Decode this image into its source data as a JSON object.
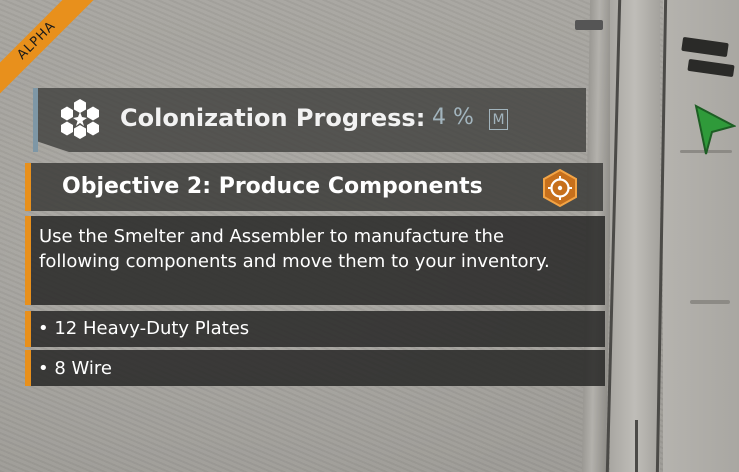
{
  "badge": {
    "text": "ALPHA"
  },
  "colonization": {
    "label": "Colonization Progress:",
    "value": "4 %",
    "key_hint": "M",
    "icon": "hex-cluster-icon"
  },
  "objective": {
    "title": "Objective 2: Produce Components",
    "icon": "target-hex-icon",
    "description": "Use the Smelter and Assembler to manufacture the following components and move them to your inventory.",
    "tasks": [
      {
        "text": "• 12 Heavy-Duty Plates"
      },
      {
        "text": "• 8 Wire"
      }
    ]
  },
  "colors": {
    "accent_orange": "#e8901c",
    "colonization_accent": "#7e97a6",
    "waypoint_green": "#2f9a3a"
  }
}
